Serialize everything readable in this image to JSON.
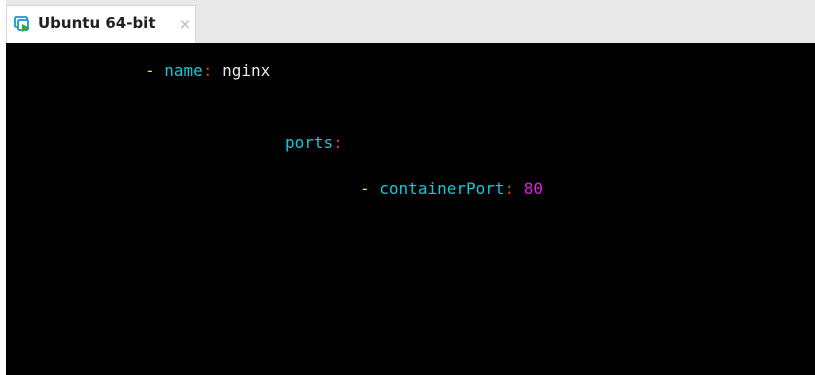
{
  "tab": {
    "title": "Ubuntu 64-bit",
    "icon": "vm-play-icon",
    "close": "×"
  },
  "terminal": {
    "lines": [
      {
        "dash": "-",
        "key": "name",
        "colon": ":",
        "value": "nginx"
      },
      {
        "key": "ports",
        "colon": ":"
      },
      {
        "dash": "-",
        "key": "containerPort",
        "colon": ":",
        "value": "80"
      }
    ]
  },
  "colors": {
    "terminal_background": "#000000",
    "dash": "#f0f000",
    "key": "#12c9d8",
    "colon": "#e82d2d",
    "text": "#e9e9e9",
    "number": "#e01fe0"
  }
}
